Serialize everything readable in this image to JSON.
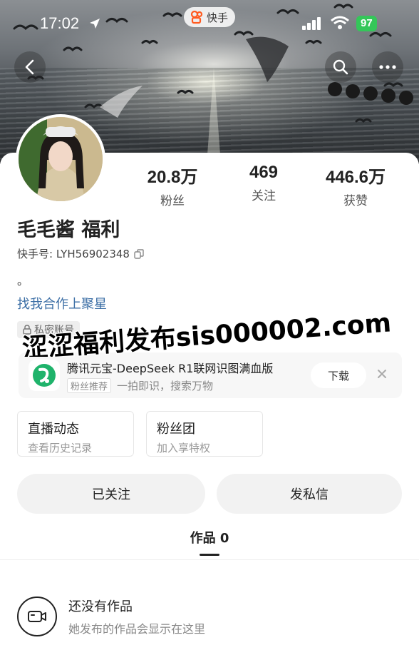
{
  "status_bar": {
    "time": "17:02",
    "app_name": "快手",
    "battery": "97"
  },
  "profile": {
    "nickname": "毛毛酱 福利",
    "uid": "快手号: LYH56902348",
    "bio": "。",
    "link": "找我合作上聚星",
    "tag": "私密账号",
    "stats": [
      {
        "value": "20.8万",
        "label": "粉丝"
      },
      {
        "value": "469",
        "label": "关注"
      },
      {
        "value": "446.6万",
        "label": "获赞"
      }
    ]
  },
  "watermark": "涩涩福利发布sis000002.com",
  "ad": {
    "title": "腾讯元宝-DeepSeek R1联网识图满血版",
    "badge": "粉丝推荐",
    "subtitle": "一拍即识，搜索万物",
    "download_label": "下载"
  },
  "features": [
    {
      "title": "直播动态",
      "subtitle": "查看历史记录"
    },
    {
      "title": "粉丝团",
      "subtitle": "加入享特权"
    }
  ],
  "actions": {
    "follow_label": "已关注",
    "message_label": "发私信"
  },
  "tabs": {
    "works_label": "作品 0"
  },
  "empty_state": {
    "title": "还没有作品",
    "subtitle": "她发布的作品会显示在这里"
  },
  "colors": {
    "link": "#3b6ea5",
    "battery": "#34c759",
    "button_bg": "#f2f2f2",
    "ad_logo": "#1fb36b"
  },
  "icons": [
    "location-arrow-icon",
    "kuaishou-logo-icon",
    "signal-icon",
    "wifi-icon",
    "back-icon",
    "search-icon",
    "more-icon",
    "copy-icon",
    "lock-icon",
    "yuanbao-logo-icon",
    "close-icon",
    "video-camera-icon"
  ]
}
